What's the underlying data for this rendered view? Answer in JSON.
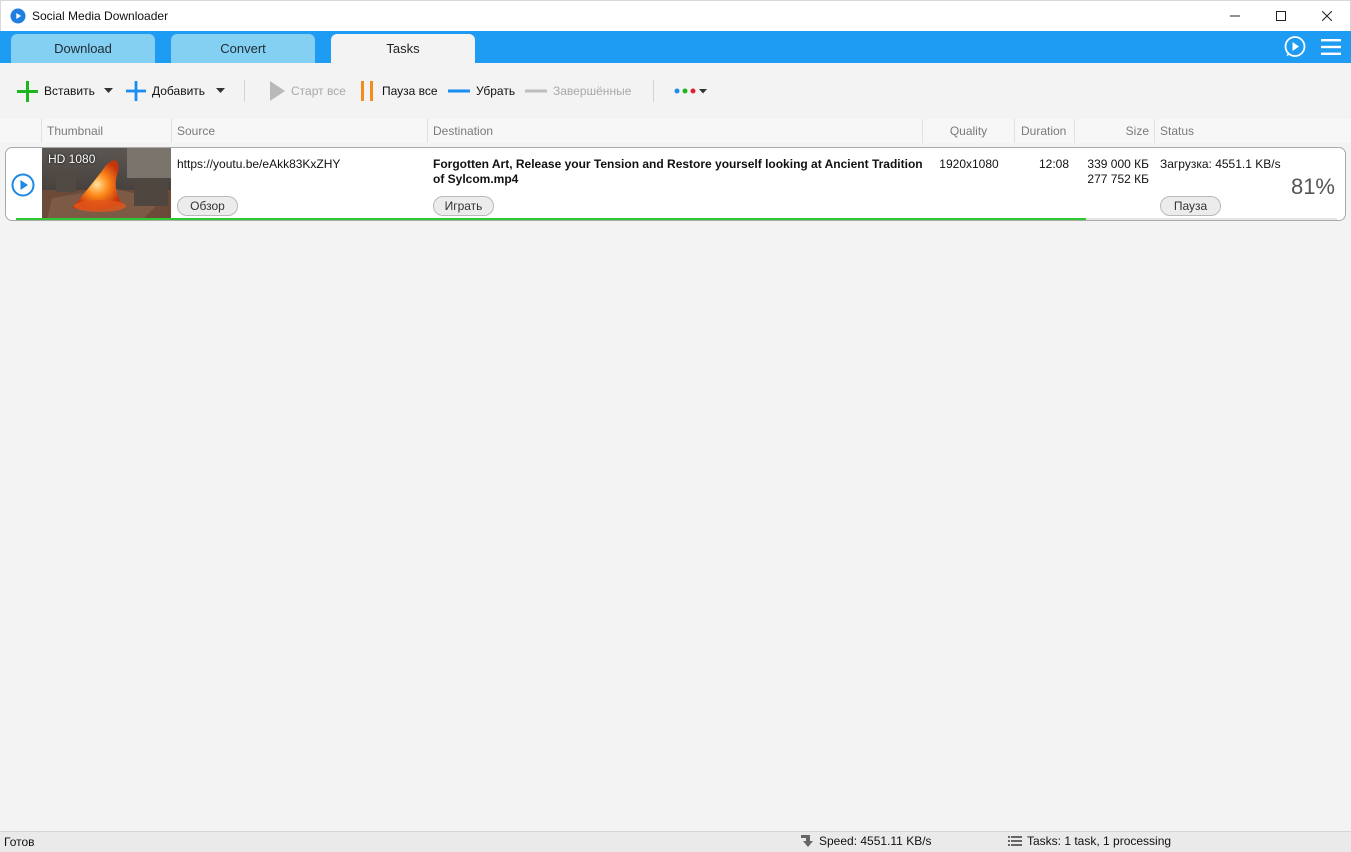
{
  "window": {
    "title": "Social Media Downloader"
  },
  "tabs": [
    {
      "label": "Download",
      "active": false
    },
    {
      "label": "Convert",
      "active": false
    },
    {
      "label": "Tasks",
      "active": true
    }
  ],
  "toolbar": {
    "paste_label": "Вставить",
    "add_label": "Добавить",
    "start_all_label": "Старт все",
    "pause_all_label": "Пауза все",
    "remove_label": "Убрать",
    "completed_label": "Завершённые"
  },
  "columns": [
    "Thumbnail",
    "Source",
    "Destination",
    "Quality",
    "Duration",
    "Size",
    "Status"
  ],
  "tasks": [
    {
      "thumbnail_badge": "HD 1080",
      "source": "https://youtu.be/eAkk83KxZHY",
      "browse_label": "Обзор",
      "destination": "Forgotten Art, Release your Tension and Restore yourself looking at Ancient Tradition of Sylcom.mp4",
      "play_label": "Играть",
      "quality": "1920x1080",
      "duration": "12:08",
      "size_total": "339 000 КБ",
      "size_downloaded": "277 752 КБ",
      "status": "Загрузка: 4551.1 KB/s",
      "pause_label": "Пауза",
      "percent": "81%",
      "progress": 0.81
    }
  ],
  "statusbar": {
    "ready": "Готов",
    "speed": "Speed: 4551.11 KB/s",
    "tasks": "Tasks: 1 task, 1 processing"
  },
  "colors": {
    "accent": "#1e9bf3",
    "tab_inactive": "#84d0f2",
    "progress": "#2ec832",
    "paste_icon": "#1fb51f",
    "add_icon": "#1a8ef0",
    "pause_icon": "#f28c1c",
    "remove_icon": "#1a8ef0"
  }
}
